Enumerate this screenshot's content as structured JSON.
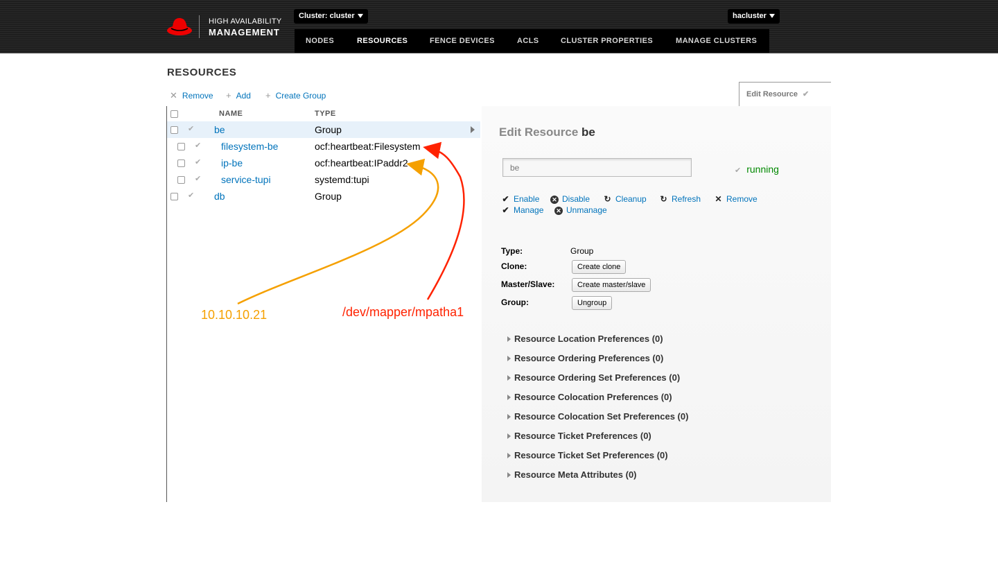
{
  "header": {
    "logo_line1": "HIGH AVAILABILITY",
    "logo_line2": "MANAGEMENT",
    "cluster_dropdown": "Cluster: cluster",
    "user_dropdown": "hacluster",
    "brand_color": "#ee0000"
  },
  "nav": {
    "items": [
      "NODES",
      "RESOURCES",
      "FENCE DEVICES",
      "ACLS",
      "CLUSTER PROPERTIES",
      "MANAGE CLUSTERS"
    ],
    "active": "RESOURCES"
  },
  "page": {
    "title": "RESOURCES"
  },
  "toolbar": {
    "remove_label": "Remove",
    "add_label": "Add",
    "create_group_label": "Create Group"
  },
  "edit_tab": {
    "label": "Edit Resource"
  },
  "table": {
    "columns": [
      "NAME",
      "TYPE"
    ],
    "rows": [
      {
        "name": "be",
        "type": "Group",
        "level": 0,
        "selected": true
      },
      {
        "name": "filesystem-be",
        "type": "ocf:heartbeat:Filesystem",
        "level": 1
      },
      {
        "name": "ip-be",
        "type": "ocf:heartbeat:IPaddr2",
        "level": 1
      },
      {
        "name": "service-tupi",
        "type": "systemd:tupi",
        "level": 1
      },
      {
        "name": "db",
        "type": "Group",
        "level": 0
      }
    ]
  },
  "detail": {
    "title_prefix": "Edit Resource",
    "resource_name": "be",
    "name_input_value": "be",
    "status": "running",
    "actions": {
      "enable": "Enable",
      "disable": "Disable",
      "cleanup": "Cleanup",
      "refresh": "Refresh",
      "remove": "Remove",
      "manage": "Manage",
      "unmanage": "Unmanage"
    },
    "props": {
      "type_label": "Type:",
      "type_value": "Group",
      "clone_label": "Clone:",
      "clone_button": "Create clone",
      "ms_label": "Master/Slave:",
      "ms_button": "Create master/slave",
      "group_label": "Group:",
      "group_button": "Ungroup"
    },
    "preferences": [
      "Resource Location Preferences (0)",
      "Resource Ordering Preferences (0)",
      "Resource Ordering Set Preferences (0)",
      "Resource Colocation Preferences (0)",
      "Resource Colocation Set Preferences (0)",
      "Resource Ticket Preferences (0)",
      "Resource Ticket Set Preferences (0)",
      "Resource Meta Attributes (0)"
    ]
  },
  "annotations": {
    "ip_note": "10.10.10.21",
    "ip_color": "#f5a000",
    "device_note": "/dev/mapper/mpatha1",
    "device_color": "#ff2200"
  }
}
